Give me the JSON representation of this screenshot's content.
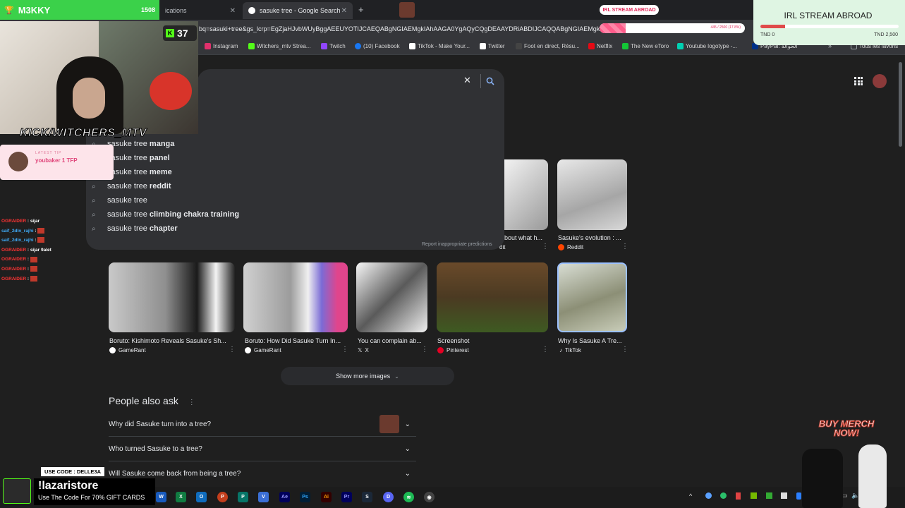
{
  "browser": {
    "tabs": [
      {
        "label": "ications",
        "active": false
      },
      {
        "label": "sasuke tree - Google Search",
        "active": true
      }
    ],
    "url": "bq=sasuki+tree&gs_lcrp=EgZjaHJvbWUyBggAEEUYOTIJCAEQABgNGIAEMgkIAhAAGA0YgAQyCQgDEAAYDRiABDIJCAQQABgNGIAEMgkIBRAAGA0YgAQ",
    "bookmarks": [
      {
        "label": "Instagram",
        "color": "#e1306c"
      },
      {
        "label": "Witchers_mtv Strea...",
        "color": "#53fc18"
      },
      {
        "label": "Twitch",
        "color": "#9146ff"
      },
      {
        "label": "(10) Facebook",
        "color": "#1877f2"
      },
      {
        "label": "TikTok - Make Your...",
        "color": "#ffffff"
      },
      {
        "label": "Twitter",
        "color": "#ffffff"
      },
      {
        "label": "Foot en direct, Résu...",
        "color": "#ffffff"
      },
      {
        "label": "Netflix",
        "color": "#e50914"
      },
      {
        "label": "The New eToro",
        "color": "#13c636"
      },
      {
        "label": "Youtube logotype -...",
        "color": "#00d1b2"
      },
      {
        "label": "PayPal: الحوالة",
        "color": "#003087"
      },
      {
        "label": "Tous les favoris",
        "color": "#9aa0a6"
      }
    ]
  },
  "search": {
    "suggestions": [
      {
        "prefix": "sasuke tree ",
        "bold": "manga"
      },
      {
        "prefix": "sasuke tree ",
        "bold": "panel"
      },
      {
        "prefix": "sasuke tree ",
        "bold": "meme"
      },
      {
        "prefix": "sasuke tree ",
        "bold": "reddit"
      },
      {
        "prefix": "sasuke tree",
        "bold": ""
      },
      {
        "prefix": "sasuke tree ",
        "bold": "climbing chakra training"
      },
      {
        "prefix": "sasuke tree ",
        "bold": "chapter"
      }
    ],
    "report": "Report inappropriate predictions"
  },
  "images_row1": [
    {
      "caption": "bout what h...",
      "source": "dit"
    },
    {
      "caption": "Sasuke's evolution : ...",
      "source": "Reddit",
      "color": "#ff4500"
    }
  ],
  "images_row2": [
    {
      "caption": "Boruto: Kishimoto Reveals Sasuke's Sh...",
      "source": "GameRant",
      "color": "#ffffff"
    },
    {
      "caption": "Boruto: How Did Sasuke Turn In...",
      "source": "GameRant",
      "color": "#ffffff"
    },
    {
      "caption": "You can complain ab...",
      "source": "X",
      "color": "#ffffff"
    },
    {
      "caption": "Screenshot",
      "source": "Pinterest",
      "color": "#e60023"
    },
    {
      "caption": "Why Is Sasuke A Tre...",
      "source": "TikTok",
      "color": "#ffffff"
    }
  ],
  "show_more": "Show more images",
  "people_also_ask": {
    "title": "People also ask",
    "questions": [
      "Why did Sasuke turn into a tree?",
      "Who turned Sasuke to a tree?",
      "Will Sasuke come back from being a tree?"
    ]
  },
  "overlay": {
    "channel": "M3KKY",
    "count": "1508",
    "kick_badge": "37",
    "kick_name": "KICK/WITCHERS_MTV",
    "tip_label": "LATEST TIP",
    "tip_text": "youbaker 1 TFP",
    "chat": [
      {
        "user": "OGRAIDER",
        "msg": "sijar",
        "color": "#ff3333"
      },
      {
        "user": "saif_2dln_rajhi",
        "msg": "",
        "color": "#3fa9f5"
      },
      {
        "user": "saif_2dln_rajhi",
        "msg": "",
        "color": "#3fa9f5"
      },
      {
        "user": "OGRAIDER",
        "msg": "sijar 9alet",
        "color": "#ff3333"
      },
      {
        "user": "OGRAIDER",
        "msg": "",
        "color": "#ff3333"
      },
      {
        "user": "OGRAIDER",
        "msg": "",
        "color": "#ff3333"
      },
      {
        "user": "OGRAIDER",
        "msg": "",
        "color": "#ff3333"
      }
    ],
    "irl_banner": "IRL STREAM ABROAD",
    "irl_title": "IRL STREAM ABROAD",
    "irl_min": "TND 0",
    "irl_max": "TND 2,500",
    "irl_progress": 0.18,
    "progress_text": "445 / 2500 (17.8%)",
    "merch": "BUY MERCH NOW!",
    "use_code": "USE CODE : DELLE3A",
    "promo_title": "!lazaristore",
    "promo_sub": "Use The Code For 70% GIFT CARDS"
  },
  "colors": {
    "accent_green": "#53fc18",
    "google_bg": "#1f1f1f",
    "panel": "#303134"
  }
}
